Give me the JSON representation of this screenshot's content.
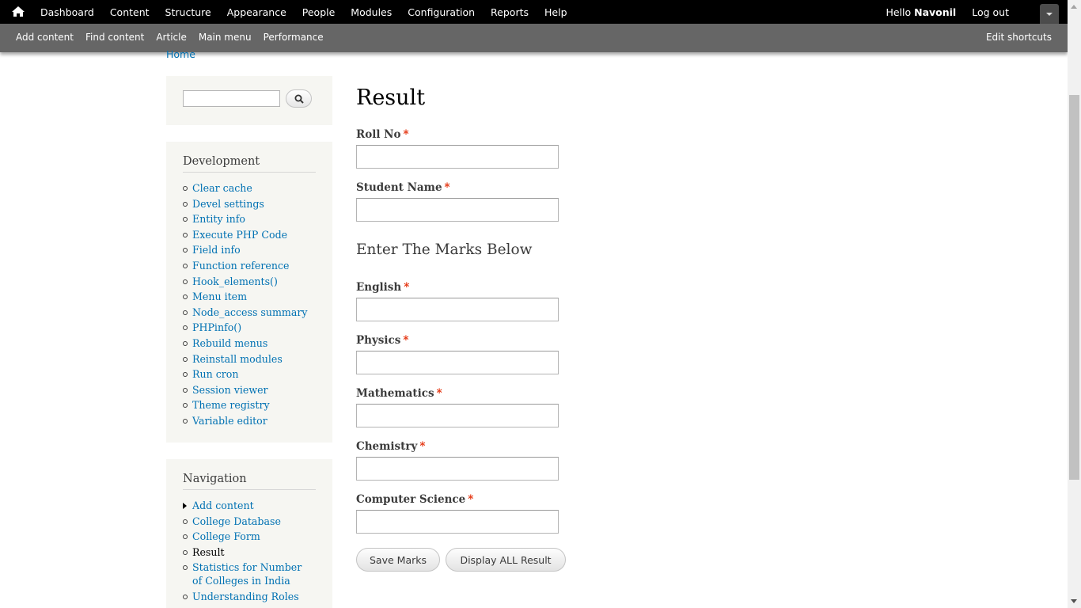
{
  "toolbar": {
    "menu": [
      "Dashboard",
      "Content",
      "Structure",
      "Appearance",
      "People",
      "Modules",
      "Configuration",
      "Reports",
      "Help"
    ],
    "hello_prefix": "Hello",
    "username": "Navonil",
    "logout": "Log out"
  },
  "shortcuts": {
    "items": [
      "Add content",
      "Find content",
      "Article",
      "Main menu",
      "Performance"
    ],
    "edit": "Edit shortcuts"
  },
  "breadcrumb": "Home",
  "sidebar": {
    "development": {
      "title": "Development",
      "items": [
        "Clear cache",
        "Devel settings",
        "Entity info",
        "Execute PHP Code",
        "Field info",
        "Function reference",
        "Hook_elements()",
        "Menu item",
        "Node_access summary",
        "PHPinfo()",
        "Rebuild menus",
        "Reinstall modules",
        "Run cron",
        "Session viewer",
        "Theme registry",
        "Variable editor"
      ]
    },
    "navigation": {
      "title": "Navigation",
      "items": [
        "Add content",
        "College Database",
        "College Form",
        "Result",
        "Statistics for Number of Colleges in India",
        "Understanding Roles"
      ]
    }
  },
  "main": {
    "title": "Result",
    "roll_no_label": "Roll No",
    "student_name_label": "Student Name",
    "marks_heading": "Enter The Marks Below",
    "english_label": "English",
    "physics_label": "Physics",
    "mathematics_label": "Mathematics",
    "chemistry_label": "Chemistry",
    "computer_science_label": "Computer Science",
    "required_marker": "*",
    "save_button": "Save Marks",
    "display_button": "Display ALL Result"
  },
  "colors": {
    "link": "#0071b3",
    "required": "#e32700",
    "toolbar_bg": "#000000",
    "shortcut_bg": "#666666",
    "sidebar_bg": "#f6f6f2"
  },
  "icons": {
    "home": "home-icon",
    "search": "search-icon",
    "drawer": "chevron-down-icon"
  }
}
